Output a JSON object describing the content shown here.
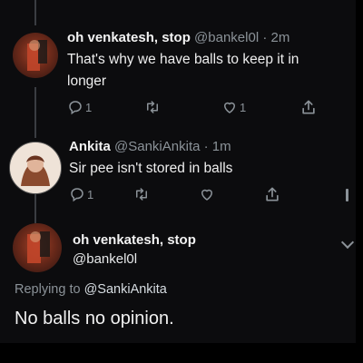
{
  "tweets": [
    {
      "name": "oh venkatesh, stop",
      "handle": "@bankel0l",
      "time": "· 2m",
      "text_line1": "That's why we have balls to keep it in",
      "text_line2": "longer",
      "replies": "1",
      "likes": "1"
    },
    {
      "name": "Ankita",
      "handle": "@SankiAnkita",
      "time": "· 1m",
      "text": "Sir pee isn't stored in balls",
      "replies": "1"
    }
  ],
  "focused_tweet": {
    "name": "oh venkatesh, stop",
    "handle": "@bankel0l",
    "replying_prefix": "Replying to",
    "replying_to": "@SankiAnkita",
    "text": "No balls no opinion."
  },
  "colors": {
    "background": "#0c0c0e",
    "text": "#e7e9ea",
    "secondary": "#8b9298"
  },
  "icons": [
    "reply-icon",
    "retweet-icon",
    "like-icon",
    "share-icon",
    "more-chevron-icon"
  ]
}
